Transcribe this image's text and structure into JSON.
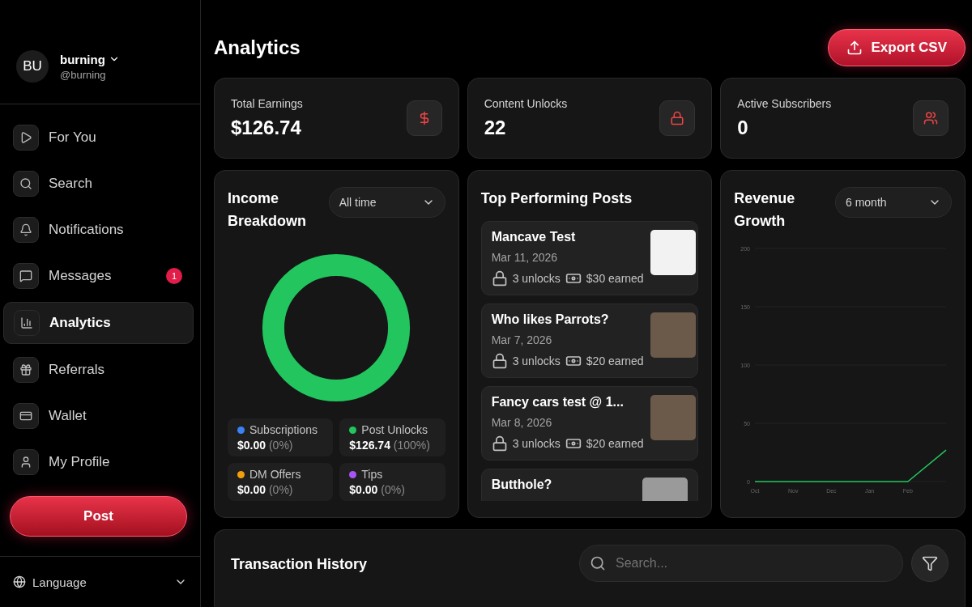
{
  "profile": {
    "initials": "BU",
    "name": "burning",
    "handle": "@burning"
  },
  "nav": [
    {
      "label": "For You",
      "selected": false
    },
    {
      "label": "Search",
      "selected": false
    },
    {
      "label": "Notifications",
      "selected": false
    },
    {
      "label": "Messages",
      "selected": false,
      "badge": "1"
    },
    {
      "label": "Analytics",
      "selected": true
    },
    {
      "label": "Referrals",
      "selected": false
    },
    {
      "label": "Wallet",
      "selected": false
    },
    {
      "label": "My Profile",
      "selected": false
    }
  ],
  "post_button": "Post",
  "language": "Language",
  "page_title": "Analytics",
  "export_button": "Export CSV",
  "stats": [
    {
      "label": "Total Earnings",
      "value": "$126.74"
    },
    {
      "label": "Content Unlocks",
      "value": "22"
    },
    {
      "label": "Active Subscribers",
      "value": "0"
    }
  ],
  "income": {
    "title": "Income Breakdown",
    "period": "All time",
    "legend": [
      {
        "name": "Subscriptions",
        "amount": "$0.00",
        "share": "(0%)",
        "color": "#3b82f6"
      },
      {
        "name": "Post Unlocks",
        "amount": "$126.74",
        "share": "(100%)",
        "color": "#22c55e"
      },
      {
        "name": "DM Offers",
        "amount": "$0.00",
        "share": "(0%)",
        "color": "#f59e0b"
      },
      {
        "name": "Tips",
        "amount": "$0.00",
        "share": "(0%)",
        "color": "#a855f7"
      }
    ]
  },
  "top_posts": {
    "title": "Top Performing Posts",
    "posts": [
      {
        "title": "Mancave Test",
        "date": "Mar 11, 2026",
        "unlocks": "3 unlocks",
        "earned": "$30 earned"
      },
      {
        "title": "Who likes Parrots?",
        "date": "Mar 7, 2026",
        "unlocks": "3 unlocks",
        "earned": "$20 earned"
      },
      {
        "title": "Fancy cars test @ 1...",
        "date": "Mar 8, 2026",
        "unlocks": "3 unlocks",
        "earned": "$20 earned"
      },
      {
        "title": "Butthole?"
      }
    ]
  },
  "revenue": {
    "title": "Revenue Growth",
    "period": "6 month",
    "chart_data": {
      "type": "line",
      "categories": [
        "Oct",
        "Nov",
        "Dec",
        "Jan",
        "Feb",
        null
      ],
      "ylim": [
        0,
        200
      ],
      "yticks": [
        0,
        50,
        100,
        150,
        200
      ],
      "grid": true,
      "series": [
        {
          "color": "#22c55e",
          "values": [
            0,
            0,
            0,
            0,
            0,
            27
          ]
        }
      ]
    }
  },
  "transactions": {
    "title": "Transaction History",
    "search_placeholder": "Search..."
  }
}
